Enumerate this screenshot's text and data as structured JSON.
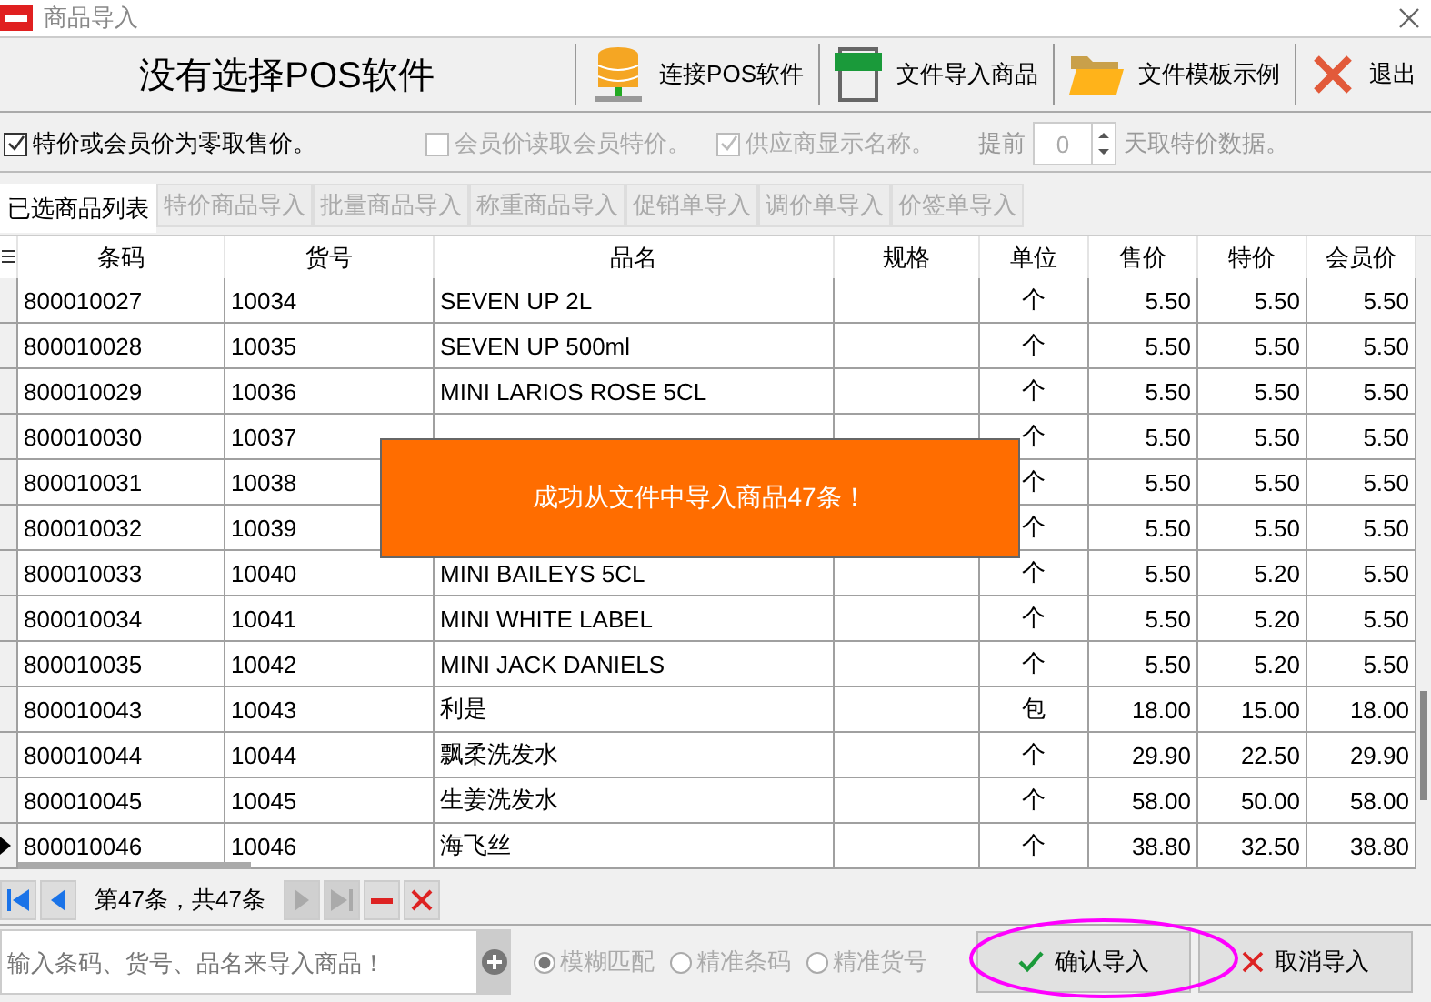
{
  "window": {
    "title": "商品导入"
  },
  "header": {
    "pos_status": "没有选择POS软件"
  },
  "toolbar": [
    {
      "kind": "database",
      "label": "连接POS软件"
    },
    {
      "kind": "xls",
      "label": "文件导入商品"
    },
    {
      "kind": "folder",
      "label": "文件模板示例"
    },
    {
      "kind": "exit",
      "label": "退出"
    }
  ],
  "options": {
    "checkboxes": [
      {
        "label": "特价或会员价为零取售价。",
        "checked": true,
        "disabled": false
      },
      {
        "label": "会员价读取会员特价。",
        "checked": false,
        "disabled": true
      },
      {
        "label": "供应商显示名称。",
        "checked": true,
        "disabled": true
      }
    ],
    "days_prefix": "提前",
    "days_value": "0",
    "days_suffix": "天取特价数据。"
  },
  "tabs": [
    {
      "label": "已选商品列表",
      "selected": true
    },
    {
      "label": "特价商品导入",
      "selected": false
    },
    {
      "label": "批量商品导入",
      "selected": false
    },
    {
      "label": "称重商品导入",
      "selected": false
    },
    {
      "label": "促销单导入",
      "selected": false
    },
    {
      "label": "调价单导入",
      "selected": false
    },
    {
      "label": "价签单导入",
      "selected": false
    }
  ],
  "table": {
    "columns": [
      "条码",
      "货号",
      "品名",
      "规格",
      "单位",
      "售价",
      "特价",
      "会员价"
    ],
    "rows": [
      {
        "barcode": "800010027",
        "item_no": "10034",
        "name": "SEVEN UP 2L",
        "unit": "个",
        "price": "5.50",
        "special": "5.50",
        "member": "5.50",
        "selected": false
      },
      {
        "barcode": "800010028",
        "item_no": "10035",
        "name": "SEVEN UP 500ml",
        "unit": "个",
        "price": "5.50",
        "special": "5.50",
        "member": "5.50",
        "selected": false
      },
      {
        "barcode": "800010029",
        "item_no": "10036",
        "name": "MINI LARIOS ROSE 5CL",
        "unit": "个",
        "price": "5.50",
        "special": "5.50",
        "member": "5.50",
        "selected": false
      },
      {
        "barcode": "800010030",
        "item_no": "10037",
        "unit": "个",
        "price": "5.50",
        "special": "5.50",
        "member": "5.50",
        "selected": false
      },
      {
        "barcode": "800010031",
        "item_no": "10038",
        "unit": "个",
        "price": "5.50",
        "special": "5.50",
        "member": "5.50",
        "selected": false
      },
      {
        "barcode": "800010032",
        "item_no": "10039",
        "unit": "个",
        "price": "5.50",
        "special": "5.50",
        "member": "5.50",
        "selected": false
      },
      {
        "barcode": "800010033",
        "item_no": "10040",
        "name": "MINI BAILEYS 5CL",
        "unit": "个",
        "price": "5.50",
        "special": "5.20",
        "member": "5.50",
        "selected": false
      },
      {
        "barcode": "800010034",
        "item_no": "10041",
        "name": "MINI WHITE LABEL",
        "unit": "个",
        "price": "5.50",
        "special": "5.20",
        "member": "5.50",
        "selected": false
      },
      {
        "barcode": "800010035",
        "item_no": "10042",
        "name": "MINI JACK DANIELS",
        "unit": "个",
        "price": "5.50",
        "special": "5.20",
        "member": "5.50",
        "selected": false
      },
      {
        "barcode": "800010043",
        "item_no": "10043",
        "name": "利是",
        "unit": "包",
        "price": "18.00",
        "special": "15.00",
        "member": "18.00",
        "selected": false
      },
      {
        "barcode": "800010044",
        "item_no": "10044",
        "name": "飘柔洗发水",
        "unit": "个",
        "price": "29.90",
        "special": "22.50",
        "member": "29.90",
        "selected": false
      },
      {
        "barcode": "800010045",
        "item_no": "10045",
        "name": "生姜洗发水",
        "unit": "个",
        "price": "58.00",
        "special": "50.00",
        "member": "58.00",
        "selected": false
      },
      {
        "barcode": "800010046",
        "item_no": "10046",
        "name": "海飞丝",
        "unit": "个",
        "price": "38.80",
        "special": "32.50",
        "member": "38.80",
        "selected": true
      }
    ]
  },
  "toast": "成功从文件中导入商品47条！",
  "navigator": {
    "buttons": [
      {
        "kind": "first",
        "disabled": false
      },
      {
        "kind": "prev",
        "disabled": false
      }
    ],
    "record_text": "第47条，共47条",
    "buttons_after": [
      {
        "kind": "next",
        "disabled": true
      },
      {
        "kind": "last",
        "disabled": true
      },
      {
        "kind": "delete",
        "disabled": false
      },
      {
        "kind": "cancel",
        "disabled": false
      }
    ]
  },
  "search": {
    "placeholder": "输入条码、货号、品名来导入商品！"
  },
  "match_modes": [
    {
      "label": "模糊匹配",
      "selected": true
    },
    {
      "label": "精准条码",
      "selected": false
    },
    {
      "label": "精准货号",
      "selected": false
    }
  ],
  "actions": [
    {
      "kind": "confirm",
      "label": "确认导入",
      "highlighted": true
    },
    {
      "kind": "cancel",
      "label": "取消导入",
      "highlighted": false
    }
  ]
}
